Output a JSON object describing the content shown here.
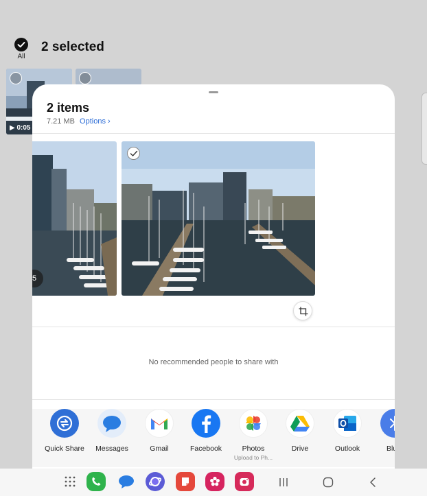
{
  "gallery": {
    "select_all_label": "All",
    "selected_title": "2 selected",
    "video_duration": "0:05"
  },
  "share_sheet": {
    "title": "2 items",
    "size": "7.21 MB",
    "options_label": "Options",
    "first_photo_badge": "5",
    "no_people_text": "No recommended people to share with",
    "apps": [
      {
        "name": "Quick Share",
        "icon": "quick-share-icon",
        "color": "#2f6fd6"
      },
      {
        "name": "Messages",
        "icon": "messages-icon",
        "color": "#2a7de1"
      },
      {
        "name": "Gmail",
        "icon": "gmail-icon",
        "color": "#ea4335"
      },
      {
        "name": "Facebook",
        "icon": "facebook-icon",
        "color": "#1877f2"
      },
      {
        "name": "Photos",
        "subtitle": "Upload to Ph...",
        "icon": "google-photos-icon",
        "color": "#fbbc04"
      },
      {
        "name": "Drive",
        "icon": "google-drive-icon",
        "color": "#0f9d58"
      },
      {
        "name": "Outlook",
        "icon": "outlook-icon",
        "color": "#0a64c8"
      },
      {
        "name": "Bluet",
        "icon": "bluetooth-icon",
        "color": "#4a7de8"
      }
    ]
  },
  "navbar": {
    "dock_apps": [
      "apps-grid-icon",
      "phone-icon",
      "messages-icon",
      "internet-icon",
      "notes-icon",
      "flower-icon",
      "camera-icon"
    ],
    "system_buttons": [
      "recents-button",
      "home-button",
      "back-button"
    ]
  }
}
